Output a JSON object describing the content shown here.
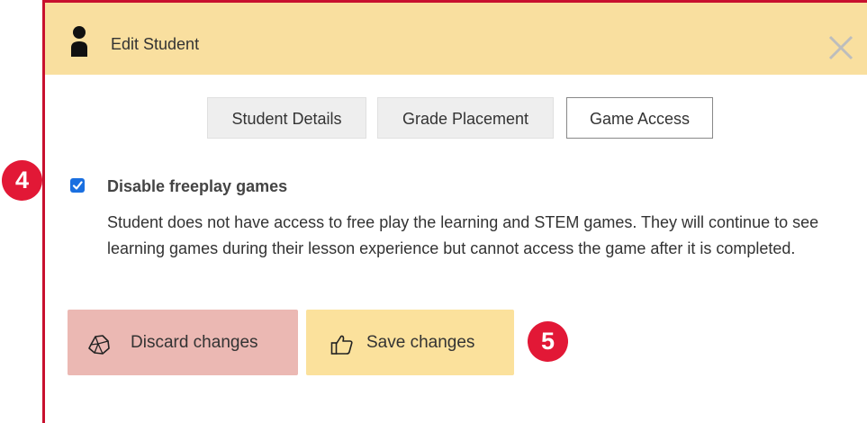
{
  "dialog": {
    "title": "Edit Student",
    "close_icon": "close-icon",
    "person_icon": "person-icon"
  },
  "tabs": [
    {
      "label": "Student Details",
      "active": false
    },
    {
      "label": "Grade Placement",
      "active": false
    },
    {
      "label": "Game Access",
      "active": true
    }
  ],
  "option": {
    "checked": true,
    "label": "Disable freeplay games",
    "description": "Student does not have access to free play the learning and STEM games. They will continue to see learning games during their lesson experience but cannot access the game after it is completed."
  },
  "buttons": {
    "discard": {
      "label": "Discard changes",
      "icon": "crumpled-paper-icon"
    },
    "save": {
      "label": "Save changes",
      "icon": "thumbs-up-icon"
    }
  },
  "annotations": {
    "step_4": "4",
    "step_5": "5"
  },
  "colors": {
    "header_bg": "#f9df9f",
    "frame_border": "#c8102e",
    "badge": "#e21836",
    "discard_bg": "#ebb8b3",
    "save_bg": "#fbe19c",
    "checkbox": "#1a6fe0"
  }
}
